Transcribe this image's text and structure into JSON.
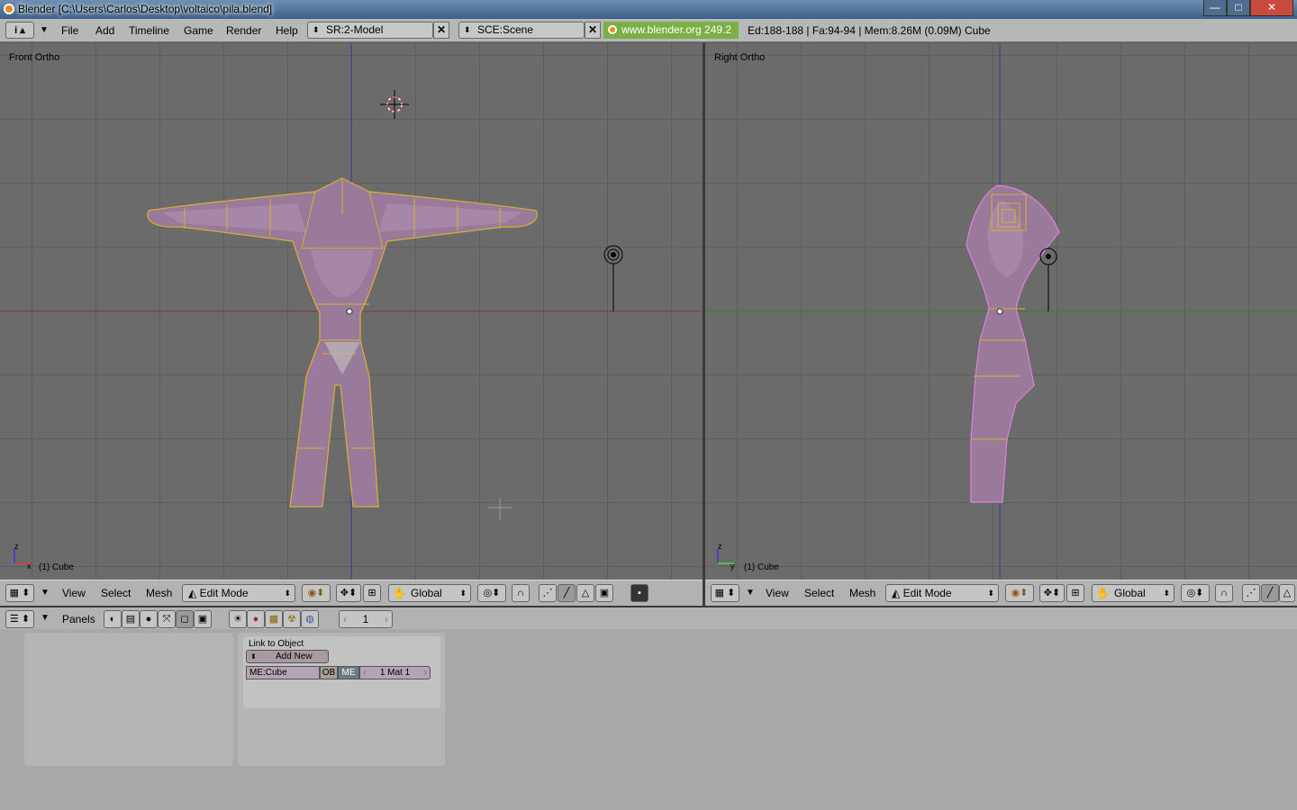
{
  "window": {
    "title": "Blender [C:\\Users\\Carlos\\Desktop\\voltaico\\pila.blend]",
    "minimize_label": "—",
    "maximize_label": "□",
    "close_label": "✕"
  },
  "menu": {
    "items": [
      "File",
      "Add",
      "Timeline",
      "Game",
      "Render",
      "Help"
    ],
    "screen_field": "SR:2-Model",
    "scene_field": "SCE:Scene",
    "website": "www.blender.org 249.2",
    "stats": "Ed:188-188 | Fa:94-94 | Mem:8.26M (0.09M) Cube"
  },
  "viewports": {
    "left_label": "Front Ortho",
    "right_label": "Right Ortho",
    "left_object": "(1) Cube",
    "right_object": "(1) Cube",
    "axis_z": "z",
    "axis_x": "x",
    "axis_y": "y"
  },
  "viewport_header": {
    "view": "View",
    "select": "Select",
    "mesh": "Mesh",
    "mode": "Edit Mode",
    "orientation": "Global"
  },
  "buttons_header": {
    "panels": "Panels",
    "frame": "1"
  },
  "link_panel": {
    "title": "Link to Object",
    "add_new": "Add New",
    "mesh_name": "ME:Cube",
    "ob_toggle": "OB",
    "me_toggle": "ME",
    "material": "1 Mat 1"
  },
  "colors": {
    "accent": "#7caf46",
    "mesh_fill": "#9a7a9a",
    "wire": "#d8b030",
    "select": "#e080e0"
  }
}
